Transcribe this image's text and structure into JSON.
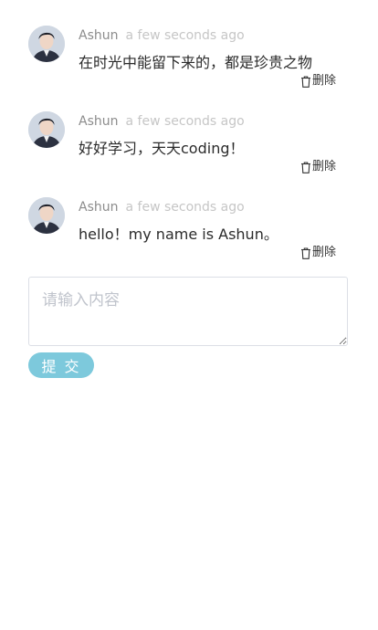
{
  "comments": [
    {
      "author": "Ashun",
      "time": "a few seconds ago",
      "content": "在时光中能留下来的，都是珍贵之物",
      "delete_label": "删除",
      "avatar_icon": "user-avatar-icon",
      "delete_icon": "trash-icon"
    },
    {
      "author": "Ashun",
      "time": "a few seconds ago",
      "content": "好好学习，天天coding！",
      "delete_label": "删除",
      "avatar_icon": "user-avatar-icon",
      "delete_icon": "trash-icon"
    },
    {
      "author": "Ashun",
      "time": "a few seconds ago",
      "content": "hello！my name is Ashun。",
      "delete_label": "删除",
      "avatar_icon": "user-avatar-icon",
      "delete_icon": "trash-icon"
    }
  ],
  "form": {
    "placeholder": "请输入内容",
    "value": "",
    "submit_label": "提 交"
  },
  "colors": {
    "submit_bg": "#7dc9dc",
    "author": "#8c8c8c",
    "time": "#c6c6c6"
  }
}
